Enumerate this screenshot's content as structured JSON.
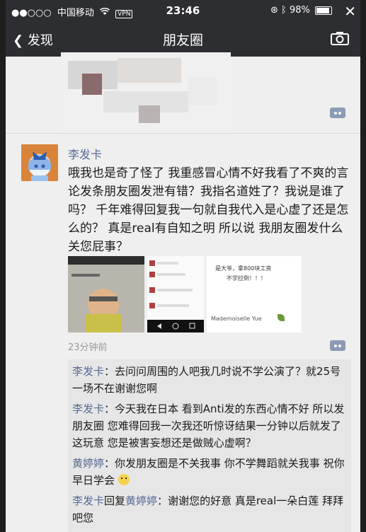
{
  "status_bar": {
    "signal": "●●○○○",
    "carrier": "中国移动",
    "wifi": "wifi-icon",
    "vpn": "VPN",
    "time": "23:46",
    "battery": "98%"
  },
  "nav": {
    "back_label": "发现",
    "title": "朋友圈"
  },
  "post": {
    "author": "李发卡",
    "text": "哦我也是奇了怪了 我重感冒心情不好我看了不爽的言论发条朋友圈发泄有错？我指名道姓了？我说是谁了吗？ 千年难得回复我一句就自我代入是心虚了还是怎么的？ 真是real有自知之明 所以说 我朋友圈发什么关您屁事？",
    "time_ago": "23分钟前",
    "thumb_texts": {
      "snippet1": "是大爷，拿800块工资",
      "snippet2": "不学拉倒！！！",
      "signature": "Mademoiselle Yue"
    }
  },
  "comments": [
    {
      "author": "李发卡",
      "sep": "：",
      "text": "去问问周围的人吧我几时说不学公演了？就25号一场不在谢谢您啊"
    },
    {
      "author": "李发卡",
      "sep": "：",
      "text": "今天我在日本 看到Anti发的东西心情不好 所以发朋友圈 您难得回我一次我还听惊讶结果一分钟以后就发了这玩意 您是被害妄想还是做贼心虚啊？"
    },
    {
      "author": "黄婷婷",
      "sep": "：",
      "text": "你发朋友圈是不关我事 你不学舞蹈就关我事 祝你早日学会"
    },
    {
      "author": "李发卡",
      "reply_word": "回复",
      "reply_to": "黄婷婷",
      "sep": "：",
      "text": "谢谢您的好意 真是real一朵白莲 拜拜吧您"
    }
  ]
}
